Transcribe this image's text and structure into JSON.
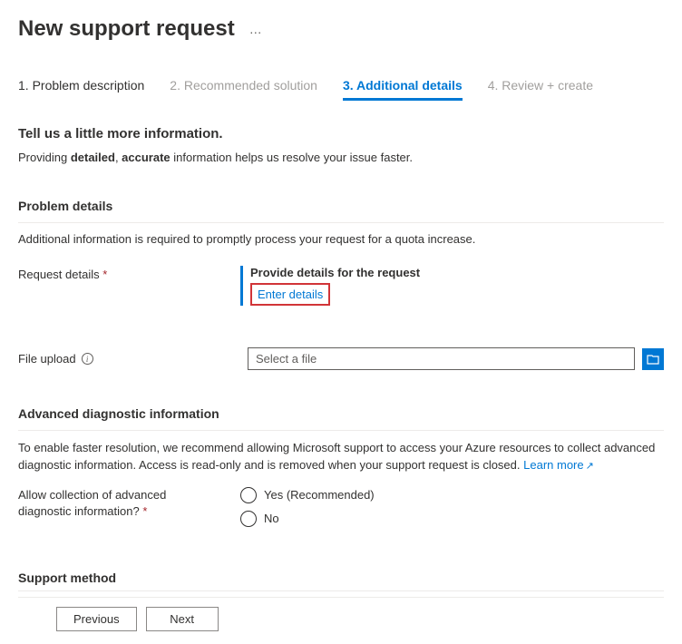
{
  "header": {
    "title": "New support request",
    "more": "…"
  },
  "tabs": [
    {
      "label": "1. Problem description"
    },
    {
      "label": "2. Recommended solution"
    },
    {
      "label": "3. Additional details"
    },
    {
      "label": "4. Review + create"
    }
  ],
  "lead": {
    "title": "Tell us a little more information.",
    "prefix": "Providing ",
    "b1": "detailed",
    "sep": ", ",
    "b2": "accurate",
    "suffix": " information helps us resolve your issue faster."
  },
  "problem": {
    "heading": "Problem details",
    "sub": "Additional information is required to promptly process your request for a quota increase.",
    "request_label": "Request details",
    "provide_title": "Provide details for the request",
    "enter_link": "Enter details"
  },
  "file": {
    "label": "File upload",
    "placeholder": "Select a file"
  },
  "advanced": {
    "heading": "Advanced diagnostic information",
    "text": "To enable faster resolution, we recommend allowing Microsoft support to access your Azure resources to collect advanced diagnostic information. Access is read-only and is removed when your support request is closed. ",
    "learn_more": "Learn more",
    "question": "Allow collection of advanced diagnostic information?",
    "opt_yes": "Yes (Recommended)",
    "opt_no": "No"
  },
  "support_method": {
    "heading": "Support method"
  },
  "footer": {
    "previous": "Previous",
    "next": "Next"
  }
}
